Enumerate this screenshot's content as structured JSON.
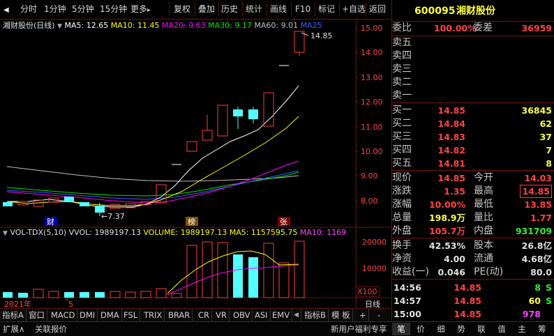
{
  "toolbar": {
    "period_tabs": [
      "分时",
      "1分钟",
      "5分钟",
      "15分钟",
      "更多"
    ],
    "more_arrow": "▸",
    "tools": [
      "复权",
      "叠加",
      "历史",
      "统计",
      "画线",
      "F10",
      "标记",
      "+自选",
      "返回"
    ]
  },
  "main_legend": {
    "title": "湘财股份(日线)",
    "ma5": "MA5: 12.65",
    "ma10": "MA10: 11.45",
    "ma20": "MA20: 9.63",
    "ma30": "MA30: 9.17",
    "ma60": "MA60: 9.01",
    "ma250": "MA25"
  },
  "price_axis": [
    "15.00",
    "14.00",
    "13.00",
    "12.00",
    "11.00",
    "10.00",
    "9.00",
    "8.00"
  ],
  "price_annotations": {
    "high": "14.85",
    "low": "7.37"
  },
  "event_markers": [
    "财",
    "榜",
    "张"
  ],
  "volume_legend": {
    "title": "VOL-TDX(5,10)",
    "vvol": "VVOL: 1989197.13",
    "volume": "VOLUME: 1989197.13",
    "ma5": "MA5: 1157595.75",
    "ma10": "MA10: 1169"
  },
  "volume_axis": [
    "20000",
    "10000"
  ],
  "volume_unit": "X100",
  "date_axis": {
    "year": "2021年",
    "month": "5",
    "period": "日线"
  },
  "indicator_tabs": [
    "指标A",
    "窗口",
    "MACD",
    "DMI",
    "DMA",
    "FSL",
    "TRIX",
    "BRAR",
    "CR",
    "VR",
    "OBV",
    "ASI",
    "EMV",
    "指标B",
    "模 板",
    "+",
    "-"
  ],
  "statusbar": {
    "left": [
      "扩展∧",
      "关联报价"
    ],
    "promo": "新用户福利专享",
    "right_tabs": [
      "笔",
      "价",
      "细",
      "势",
      "联",
      "值",
      "主",
      "筹"
    ]
  },
  "quote": {
    "code": "600095",
    "name": "湘财股份",
    "weibi_label": "委比",
    "weibi": "100.00%",
    "weicha_label": "委差",
    "weicha": "36959",
    "sells": [
      {
        "label": "卖五",
        "price": "",
        "vol": ""
      },
      {
        "label": "卖四",
        "price": "",
        "vol": ""
      },
      {
        "label": "卖三",
        "price": "",
        "vol": ""
      },
      {
        "label": "卖二",
        "price": "",
        "vol": ""
      },
      {
        "label": "卖一",
        "price": "",
        "vol": ""
      }
    ],
    "buys": [
      {
        "label": "买一",
        "price": "14.85",
        "vol": "36845"
      },
      {
        "label": "买二",
        "price": "14.84",
        "vol": "62"
      },
      {
        "label": "买三",
        "price": "14.83",
        "vol": "37"
      },
      {
        "label": "买四",
        "price": "14.82",
        "vol": "7"
      },
      {
        "label": "买五",
        "price": "14.81",
        "vol": "8"
      }
    ],
    "stats": [
      {
        "l1": "现价",
        "v1": "14.85",
        "l2": "今开",
        "v2": "14.03"
      },
      {
        "l1": "涨跌",
        "v1": "1.35",
        "l2": "最高",
        "v2": "14.85"
      },
      {
        "l1": "涨幅",
        "v1": "10.00%",
        "l2": "最低",
        "v2": "13.85"
      },
      {
        "l1": "总量",
        "v1": "198.9万",
        "l2": "量比",
        "v2": "1.77"
      },
      {
        "l1": "外盘",
        "v1": "105.7万",
        "l2": "内盘",
        "v2": "931709"
      }
    ],
    "stats2": [
      {
        "l1": "换手",
        "v1": "42.53%",
        "l2": "股本",
        "v2": "26.8亿"
      },
      {
        "l1": "净资",
        "v1": "4.00",
        "l2": "流通",
        "v2": "4.68亿"
      },
      {
        "l1": "收益(一)",
        "v1": "0.046",
        "l2": "PE(动)",
        "v2": "80.0"
      }
    ],
    "ticks": [
      {
        "time": "14:56",
        "price": "14.85",
        "vol": "8",
        "side": "S"
      },
      {
        "time": "14:57",
        "price": "14.85",
        "vol": "60",
        "side": "S"
      },
      {
        "time": "15:00",
        "price": "14.85",
        "vol": "978",
        "side": ""
      }
    ]
  },
  "colors": {
    "up": "#ff3c3c",
    "down": "#54ffff",
    "ma5": "#ffffff",
    "ma10": "#ffff00",
    "ma20": "#ff00ff",
    "ma30": "#00e000",
    "ma60": "#c0c0c0",
    "border": "#7a1010"
  }
}
